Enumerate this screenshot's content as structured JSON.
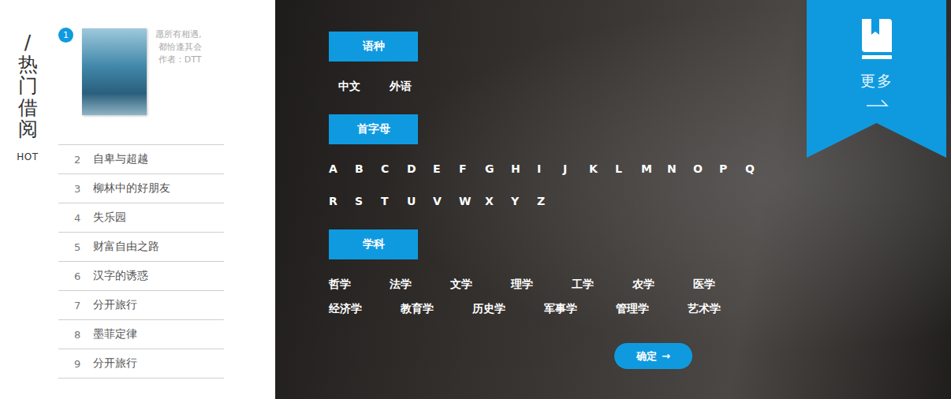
{
  "hot": {
    "title": "/热门借阅",
    "subtitle": "HOT"
  },
  "featured": {
    "rank": "1",
    "lines": [
      "愿所有相遇,",
      "都恰逢其会"
    ],
    "author": "作者：DTT"
  },
  "list": [
    {
      "rank": "2",
      "title": "自卑与超越"
    },
    {
      "rank": "3",
      "title": "柳林中的好朋友"
    },
    {
      "rank": "4",
      "title": "失乐园"
    },
    {
      "rank": "5",
      "title": "财富自由之路"
    },
    {
      "rank": "6",
      "title": "汉字的诱惑"
    },
    {
      "rank": "7",
      "title": "分开旅行"
    },
    {
      "rank": "8",
      "title": "墨菲定律"
    },
    {
      "rank": "9",
      "title": "分开旅行"
    }
  ],
  "filters": [
    {
      "label": "语种",
      "kind": "language",
      "rows": [
        [
          {
            "label": "中文",
            "selected": false
          },
          {
            "label": "外语",
            "selected": false
          }
        ]
      ]
    },
    {
      "label": "首字母",
      "kind": "letters",
      "rows": [
        [
          {
            "label": "A",
            "selected": false
          },
          {
            "label": "B",
            "selected": false
          },
          {
            "label": "C",
            "selected": false
          },
          {
            "label": "D",
            "selected": false
          },
          {
            "label": "E",
            "selected": false
          },
          {
            "label": "F",
            "selected": false
          },
          {
            "label": "G",
            "selected": false
          },
          {
            "label": "H",
            "selected": false
          },
          {
            "label": "I",
            "selected": false
          },
          {
            "label": "J",
            "selected": false
          },
          {
            "label": "K",
            "selected": false
          },
          {
            "label": "L",
            "selected": false
          },
          {
            "label": "M",
            "selected": false
          },
          {
            "label": "N",
            "selected": false
          },
          {
            "label": "O",
            "selected": false
          },
          {
            "label": "P",
            "selected": false
          },
          {
            "label": "Q",
            "selected": false
          }
        ],
        [
          {
            "label": "R",
            "selected": false
          },
          {
            "label": "S",
            "selected": false
          },
          {
            "label": "T",
            "selected": false
          },
          {
            "label": "U",
            "selected": false
          },
          {
            "label": "V",
            "selected": false
          },
          {
            "label": "W",
            "selected": false
          },
          {
            "label": "X",
            "selected": false
          },
          {
            "label": "Y",
            "selected": false
          },
          {
            "label": "Z",
            "selected": false
          }
        ]
      ]
    },
    {
      "label": "学科",
      "kind": "subjects",
      "rows": [
        [
          {
            "label": "哲学",
            "selected": false
          },
          {
            "label": "法学",
            "selected": false
          },
          {
            "label": "文学",
            "selected": false
          },
          {
            "label": "理学",
            "selected": false
          },
          {
            "label": "工学",
            "selected": false
          },
          {
            "label": "农学",
            "selected": false
          },
          {
            "label": "医学",
            "selected": false
          }
        ],
        [
          {
            "label": "经济学",
            "selected": false
          },
          {
            "label": "教育学",
            "selected": false
          },
          {
            "label": "历史学",
            "selected": false
          },
          {
            "label": "军事学",
            "selected": false
          },
          {
            "label": "管理学",
            "selected": false
          },
          {
            "label": "艺术学",
            "selected": false
          }
        ]
      ]
    }
  ],
  "confirm": {
    "label": "确定",
    "icon": "→"
  },
  "more": {
    "label": "更多"
  }
}
